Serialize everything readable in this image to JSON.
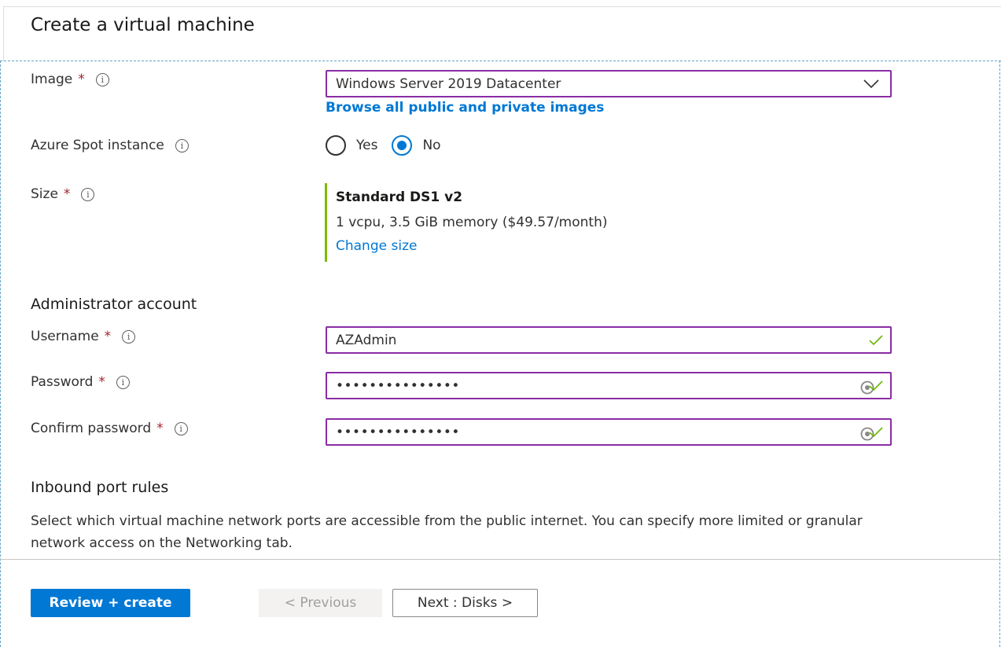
{
  "page": {
    "title": "Create a virtual machine"
  },
  "fields": {
    "image": {
      "label": "Image",
      "required_mark": "*",
      "value": "Windows Server 2019 Datacenter",
      "browse_link": "Browse all public and private images"
    },
    "spot": {
      "label": "Azure Spot instance",
      "options": [
        "Yes",
        "No"
      ],
      "selected": "No"
    },
    "size": {
      "label": "Size",
      "required_mark": "*",
      "name": "Standard DS1 v2",
      "description": "1 vcpu, 3.5 GiB memory ($49.57/month)",
      "change_link": "Change size"
    }
  },
  "admin": {
    "heading": "Administrator account",
    "username": {
      "label": "Username",
      "required_mark": "*",
      "value": "AZAdmin"
    },
    "password": {
      "label": "Password",
      "required_mark": "*",
      "value": "•••••••••••••••"
    },
    "confirm_password": {
      "label": "Confirm password",
      "required_mark": "*",
      "value": "•••••••••••••••"
    }
  },
  "inbound": {
    "heading": "Inbound port rules",
    "description": "Select which virtual machine network ports are accessible from the public internet. You can specify more limited or granular network access on the Networking tab."
  },
  "footer": {
    "review_create": "Review + create",
    "previous": "< Previous",
    "next": "Next : Disks >"
  },
  "icons": {
    "info": "info-icon",
    "chevron": "chevron-down-icon",
    "valid": "checkmark-icon",
    "reveal": "eye-icon"
  },
  "colors": {
    "accent": "#0078d4",
    "focus_border": "#8a2da5",
    "required": "#a4262c",
    "valid": "#6bb700",
    "size_bar": "#7fba00"
  }
}
